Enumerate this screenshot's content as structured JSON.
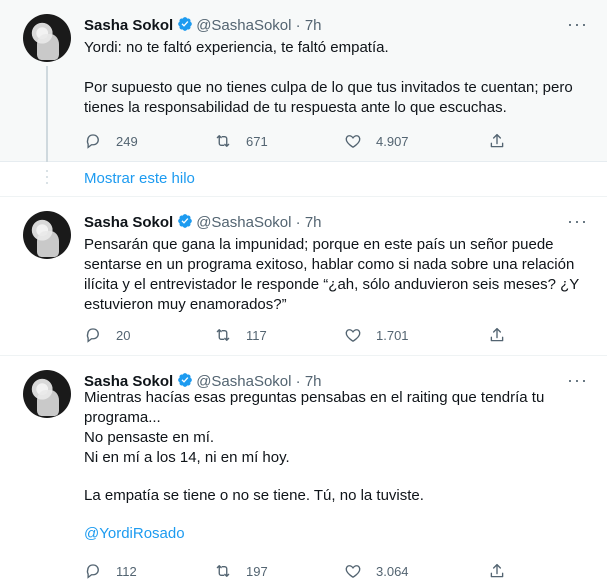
{
  "colors": {
    "accent": "#1d9bf0",
    "muted": "#536471",
    "text": "#0f1419",
    "verified": "#1d9bf0"
  },
  "tweets": [
    {
      "name": "Sasha Sokol",
      "handle": "@SashaSokol",
      "time": "· 7h",
      "paragraphs": [
        "Yordi: no te faltó experiencia, te faltó empatía.",
        "Por supuesto que no tienes culpa de lo que tus invitados te cuentan; pero tienes la responsabilidad de tu respuesta ante lo que escuchas."
      ],
      "replies": "249",
      "retweets": "671",
      "likes": "4.907"
    },
    {
      "name": "Sasha Sokol",
      "handle": "@SashaSokol",
      "time": "· 7h",
      "paragraphs": [
        "Pensarán que gana la impunidad; porque en este país un señor puede sentarse en un programa exitoso, hablar como si nada sobre una relación ilícita y el entrevistador le responde “¿ah, sólo anduvieron seis meses? ¿Y estuvieron muy enamorados?”"
      ],
      "replies": "20",
      "retweets": "117",
      "likes": "1.701"
    },
    {
      "name": "Sasha Sokol",
      "handle": "@SashaSokol",
      "time": "· 7h",
      "lines": [
        "Mientras hacías esas preguntas pensabas en el raiting que tendría tu programa...",
        "No pensaste en mí.",
        "Ni en mí a los 14, ni en mí hoy."
      ],
      "paragraph2": "La empatía se tiene o no se tiene. Tú, no la tuviste.",
      "mention": "@YordiRosado",
      "replies": "112",
      "retweets": "197",
      "likes": "3.064"
    }
  ],
  "show_thread": "Mostrar este hilo",
  "icons": [
    "reply-icon",
    "retweet-icon",
    "like-icon",
    "share-icon",
    "verified-badge-icon",
    "more-options-icon"
  ]
}
